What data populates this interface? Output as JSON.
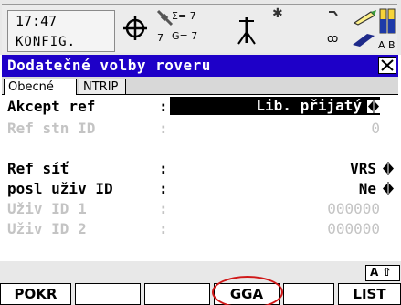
{
  "status": {
    "time": "17:47",
    "mode": "KONFIG.",
    "sat_upper": "Σ= 7",
    "sat_left": "7",
    "sat_lower": "G= 7",
    "battery_label_a": "A",
    "battery_label_b": "B"
  },
  "dialog": {
    "title": "Dodatečné volby roveru",
    "close_symbol": "×"
  },
  "tabs": [
    {
      "label": "Obecné"
    },
    {
      "label": "NTRIP"
    }
  ],
  "fields": [
    {
      "label": "Akcept ref",
      "value": "Lib. přijatý"
    },
    {
      "label": "Ref stn ID",
      "value": "0"
    },
    {
      "label": "Ref síť",
      "value": "VRS"
    },
    {
      "label": "posl uživ ID",
      "value": "Ne"
    },
    {
      "label": "Uživ ID 1",
      "value": "000000"
    },
    {
      "label": "Uživ ID 2",
      "value": "000000"
    }
  ],
  "field_separator": ":",
  "softkeys": {
    "aux_label": "A ⇧",
    "f1": "POKR",
    "f2": "",
    "f3": "",
    "f4": "GGA",
    "f5": "",
    "f6": "LIST"
  },
  "colors": {
    "title_bar": "#1e00c8",
    "highlight_circle": "#d01818",
    "disabled_text": "#c4c4c4"
  }
}
